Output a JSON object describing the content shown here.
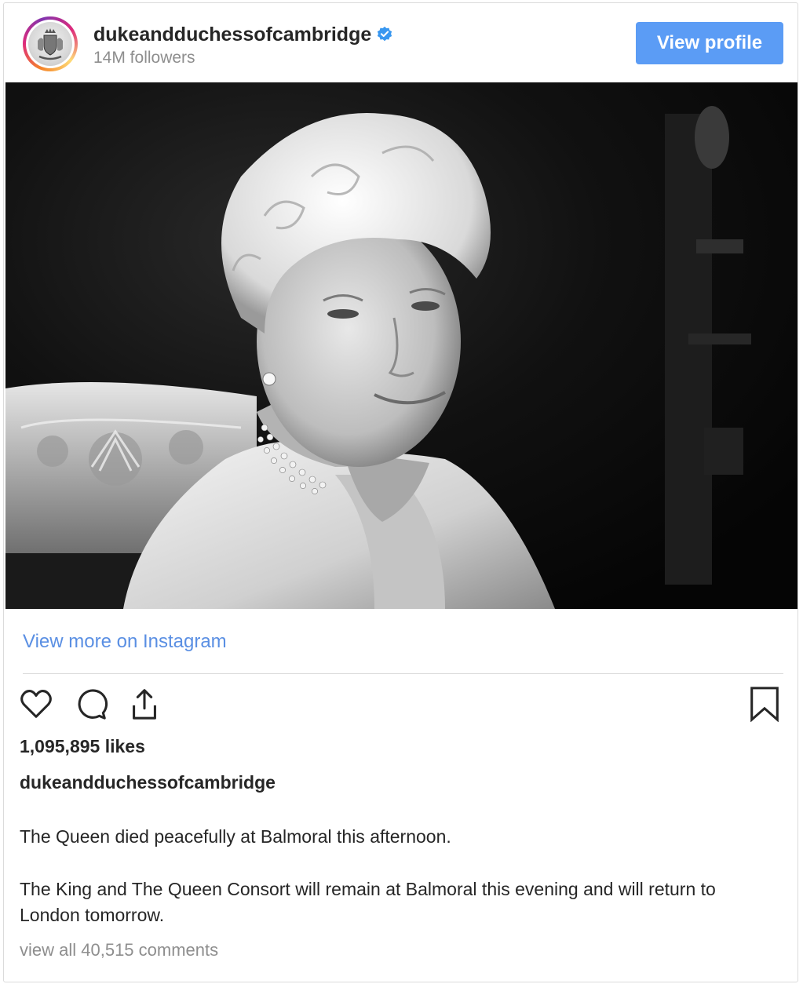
{
  "header": {
    "username": "dukeandduchessofcambridge",
    "followers": "14M followers",
    "view_profile_label": "View profile",
    "verified_icon": "verified-badge-icon",
    "avatar_icon": "royal-crest-icon"
  },
  "photo": {
    "icon": "portrait-photo"
  },
  "footer": {
    "view_more_label": "View more on Instagram",
    "action_icons": [
      "heart-icon",
      "comment-icon",
      "share-icon",
      "bookmark-icon"
    ],
    "likes": "1,095,895 likes",
    "caption_user": "dukeandduchessofcambridge",
    "caption_line_1": "The Queen died peacefully at Balmoral this afternoon.",
    "caption_line_2": "The King and The Queen Consort will remain at Balmoral this evening and will return to London tomorrow.",
    "comments_label": "view all 40,515 comments"
  },
  "colors": {
    "button_blue": "#5b9cf5",
    "link_blue": "#5a8fe3",
    "verified_blue": "#3897f0",
    "text": "#262626",
    "muted": "#8e8e8e"
  }
}
